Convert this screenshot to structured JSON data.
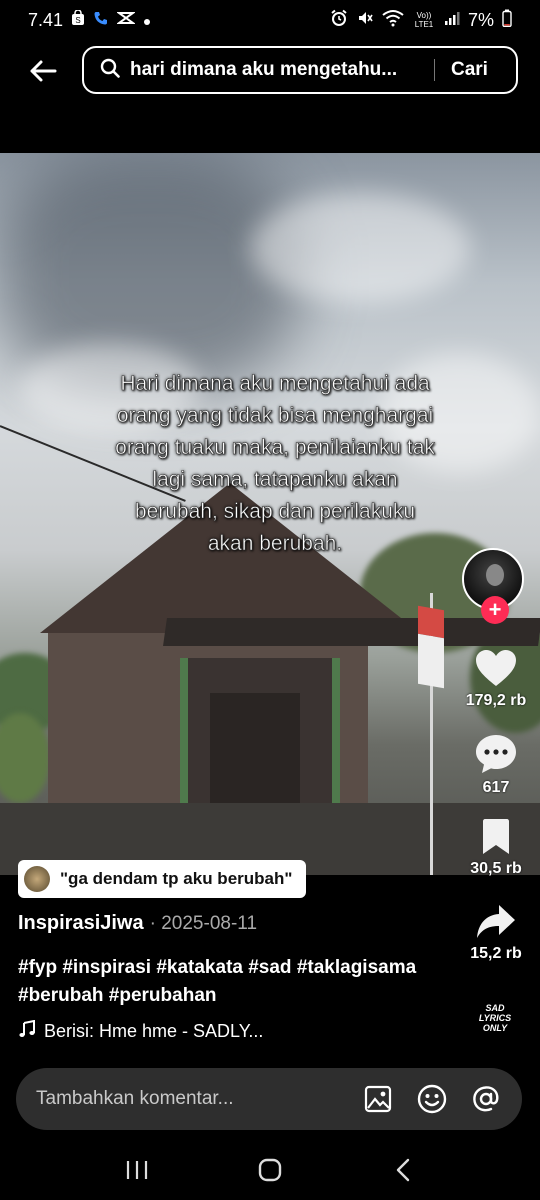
{
  "status_bar": {
    "time": "7.41",
    "battery": "7%",
    "left_icons": [
      "shopping-bag-icon",
      "phone-icon",
      "capcut-icon",
      "dot-icon"
    ],
    "right_icons": [
      "alarm-icon",
      "mute-icon",
      "wifi-icon",
      "volte-icon",
      "signal-icon",
      "battery-icon"
    ],
    "volte_label": "Vo)) LTE1"
  },
  "search": {
    "query": "hari dimana aku mengetahu...",
    "submit_label": "Cari"
  },
  "video": {
    "overlay_text": "Hari dimana aku mengetahui ada orang yang tidak bisa menghargai orang tuaku maka, penilaianku tak lagi sama, tatapanku akan berubah, sikap dan perilakuku akan berubah."
  },
  "actions": {
    "like_count": "179,2 rb",
    "comment_count": "617",
    "save_count": "30,5 rb",
    "share_count": "15,2 rb",
    "music_disc_text": "SAD LYRICS ONLY"
  },
  "caption": {
    "topic": "\"ga dendam tp aku berubah\"",
    "author": "InspirasiJiwa",
    "date": "· 2025-08-11",
    "hashtags": "#fyp #inspirasi #katakata #sad #taklagisama #berubah #perubahan",
    "sound": "Berisi: Hme hme - SADLY..."
  },
  "comment_bar": {
    "placeholder": "Tambahkan komentar..."
  },
  "colors": {
    "accent": "#fe2c55",
    "background": "#000000",
    "comment_bar": "#2e2e2e"
  }
}
